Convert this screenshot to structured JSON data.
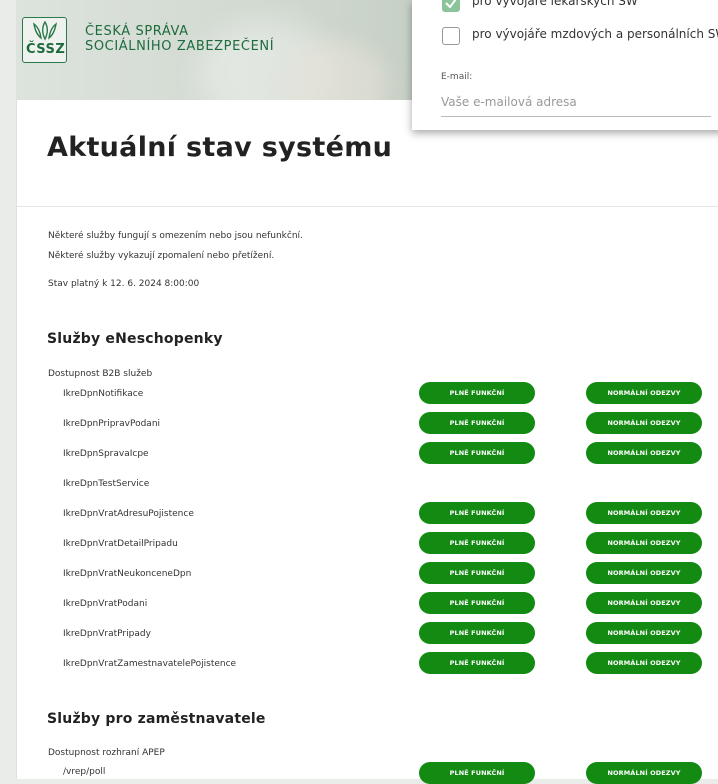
{
  "header": {
    "logo_abbr": "ČSSZ",
    "org_line1": "ČESKÁ SPRÁVA",
    "org_line2": "SOCIÁLNÍHO ZABEZPEČENÍ"
  },
  "popup": {
    "options": [
      {
        "label": "pro vývojáře lékařských SW",
        "checked": true
      },
      {
        "label": "pro vývojáře mzdových a personálních SW",
        "checked": false
      }
    ],
    "email_label": "E-mail:",
    "email_placeholder": "Vaše e-mailová adresa",
    "email_value": ""
  },
  "page_title": "Aktuální stav systému",
  "notes": [
    "Některé služby fungují s omezením nebo jsou nefunkční.",
    "Některé služby vykazují zpomalení nebo přetížení.",
    "Stav platný k 12. 6. 2024 8:00:00"
  ],
  "sections": [
    {
      "title": "Služby eNeschopenky",
      "group": "Dostupnost B2B služeb",
      "services": [
        {
          "name": "IkreDpnNotifikace",
          "functional": "PLNĚ FUNKČNÍ",
          "response": "NORMÁLNÍ ODEZVY"
        },
        {
          "name": "IkreDpnPripravPodani",
          "functional": "PLNĚ FUNKČNÍ",
          "response": "NORMÁLNÍ ODEZVY"
        },
        {
          "name": "IkreDpnSpravaIcpe",
          "functional": "PLNĚ FUNKČNÍ",
          "response": "NORMÁLNÍ ODEZVY"
        },
        {
          "name": "IkreDpnTestService",
          "functional": "",
          "response": ""
        },
        {
          "name": "IkreDpnVratAdresuPojistence",
          "functional": "PLNĚ FUNKČNÍ",
          "response": "NORMÁLNÍ ODEZVY"
        },
        {
          "name": "IkreDpnVratDetailPripadu",
          "functional": "PLNĚ FUNKČNÍ",
          "response": "NORMÁLNÍ ODEZVY"
        },
        {
          "name": "IkreDpnVratNeukonceneDpn",
          "functional": "PLNĚ FUNKČNÍ",
          "response": "NORMÁLNÍ ODEZVY"
        },
        {
          "name": "IkreDpnVratPodani",
          "functional": "PLNĚ FUNKČNÍ",
          "response": "NORMÁLNÍ ODEZVY"
        },
        {
          "name": "IkreDpnVratPripady",
          "functional": "PLNĚ FUNKČNÍ",
          "response": "NORMÁLNÍ ODEZVY"
        },
        {
          "name": "IkreDpnVratZamestnavatelePojistence",
          "functional": "PLNĚ FUNKČNÍ",
          "response": "NORMÁLNÍ ODEZVY"
        }
      ]
    },
    {
      "title": "Služby pro zaměstnavatele",
      "group": "Dostupnost rozhraní APEP",
      "services": [
        {
          "name": "/vrep/poll",
          "functional": "PLNĚ FUNKČNÍ",
          "response": "NORMÁLNÍ ODEZVY"
        }
      ]
    }
  ],
  "colors": {
    "status_green": "#138a12",
    "brand_green": "#1d6b3d",
    "checkbox_checked": "#8bc49a"
  },
  "icons": {
    "logo": "cssz-leaf-icon",
    "checkbox_checked": "check-icon"
  }
}
